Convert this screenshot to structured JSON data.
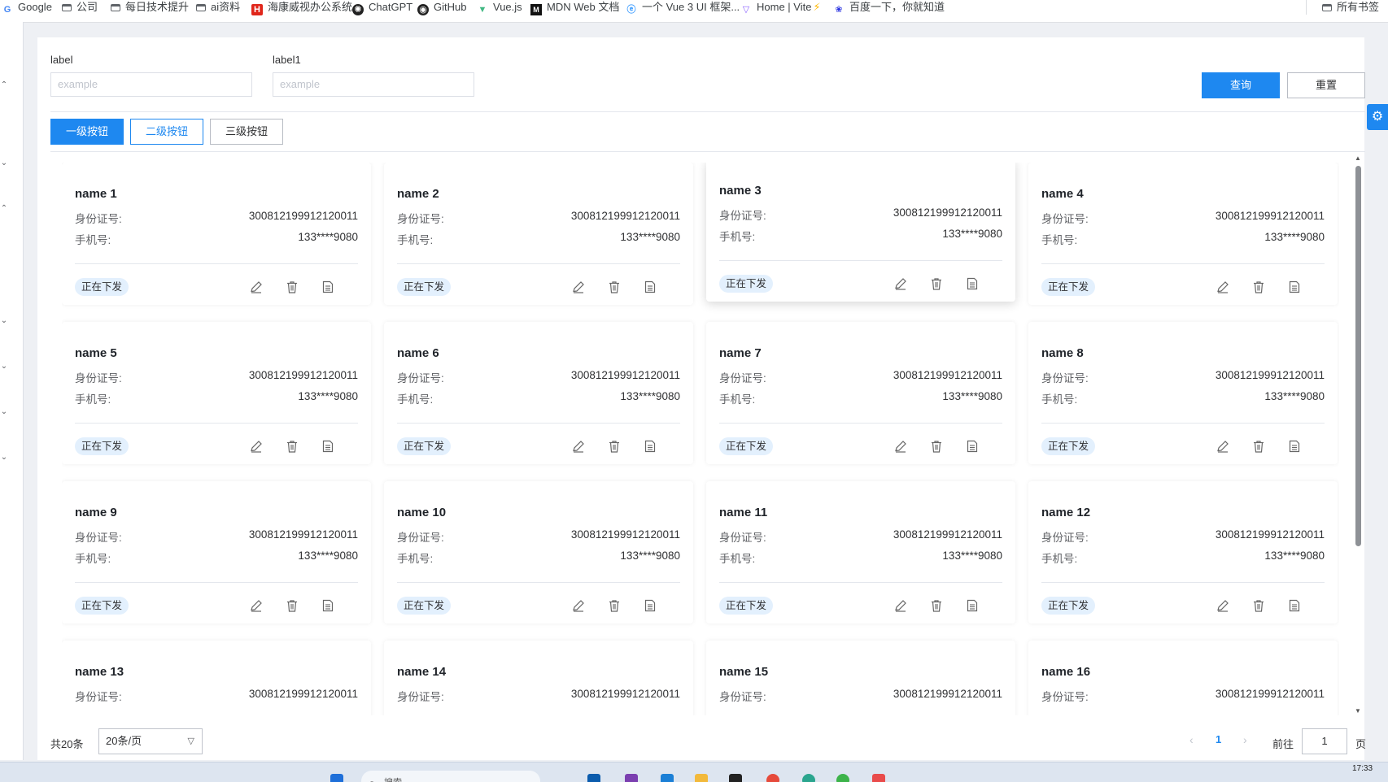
{
  "bookmarks": [
    {
      "label": "Google",
      "icon": "google-icon"
    },
    {
      "label": "公司",
      "icon": "folder-icon"
    },
    {
      "label": "每日技术提升",
      "icon": "folder-icon"
    },
    {
      "label": "ai资料",
      "icon": "folder-icon"
    },
    {
      "label": "海康威视办公系统",
      "icon": "hikvision-icon"
    },
    {
      "label": "ChatGPT",
      "icon": "chatgpt-icon"
    },
    {
      "label": "GitHub",
      "icon": "github-icon"
    },
    {
      "label": "Vue.js",
      "icon": "vue-icon"
    },
    {
      "label": "MDN Web 文档",
      "icon": "mdn-icon"
    },
    {
      "label": "一个 Vue 3 UI 框架...",
      "icon": "element-icon"
    },
    {
      "label": "Home | Vite",
      "icon": "vite-icon"
    },
    {
      "label": "百度一下，你就知道",
      "icon": "baidu-icon"
    },
    {
      "label": "所有书签",
      "icon": "folder-icon"
    }
  ],
  "search": {
    "label1": "label",
    "placeholder1": "example",
    "label2": "label1",
    "placeholder2": "example",
    "query_label": "查询",
    "reset_label": "重置"
  },
  "toolbar": {
    "primary_label": "一级按钮",
    "secondary_label": "二级按钮",
    "tertiary_label": "三级按钮"
  },
  "card_fields": {
    "id_label": "身份证号:",
    "phone_label": "手机号:"
  },
  "cards": [
    {
      "name": "name 1",
      "id": "300812199912120011",
      "phone": "133****9080",
      "status": "正在下发"
    },
    {
      "name": "name 2",
      "id": "300812199912120011",
      "phone": "133****9080",
      "status": "正在下发"
    },
    {
      "name": "name 3",
      "id": "300812199912120011",
      "phone": "133****9080",
      "status": "正在下发"
    },
    {
      "name": "name 4",
      "id": "300812199912120011",
      "phone": "133****9080",
      "status": "正在下发"
    },
    {
      "name": "name 5",
      "id": "300812199912120011",
      "phone": "133****9080",
      "status": "正在下发"
    },
    {
      "name": "name 6",
      "id": "300812199912120011",
      "phone": "133****9080",
      "status": "正在下发"
    },
    {
      "name": "name 7",
      "id": "300812199912120011",
      "phone": "133****9080",
      "status": "正在下发"
    },
    {
      "name": "name 8",
      "id": "300812199912120011",
      "phone": "133****9080",
      "status": "正在下发"
    },
    {
      "name": "name 9",
      "id": "300812199912120011",
      "phone": "133****9080",
      "status": "正在下发"
    },
    {
      "name": "name 10",
      "id": "300812199912120011",
      "phone": "133****9080",
      "status": "正在下发"
    },
    {
      "name": "name 11",
      "id": "300812199912120011",
      "phone": "133****9080",
      "status": "正在下发"
    },
    {
      "name": "name 12",
      "id": "300812199912120011",
      "phone": "133****9080",
      "status": "正在下发"
    },
    {
      "name": "name 13",
      "id": "300812199912120011",
      "phone": "",
      "status": ""
    },
    {
      "name": "name 14",
      "id": "300812199912120011",
      "phone": "",
      "status": ""
    },
    {
      "name": "name 15",
      "id": "300812199912120011",
      "phone": "",
      "status": ""
    },
    {
      "name": "name 16",
      "id": "300812199912120011",
      "phone": "",
      "status": ""
    }
  ],
  "pagination": {
    "total_text": "共20条",
    "page_size_text": "20条/页",
    "current_page": "1",
    "goto_prefix": "前往",
    "goto_value": "1",
    "goto_suffix": "页"
  },
  "taskbar": {
    "search_placeholder": "搜索",
    "time": "17:33"
  },
  "colors": {
    "primary": "#1e88f0",
    "tag_bg": "#e3f0fd",
    "page_bg": "#eef0f4"
  }
}
